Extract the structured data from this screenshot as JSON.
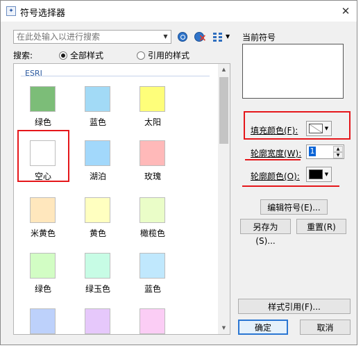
{
  "window": {
    "title": "符号选择器",
    "close_glyph": "✕"
  },
  "search": {
    "placeholder": "在此处输入以进行搜索",
    "label": "搜索:",
    "scope_all": "全部样式",
    "scope_referenced": "引用的样式",
    "selected_scope": "全部样式"
  },
  "symbol_group": {
    "name": "ESRI"
  },
  "symbols": [
    {
      "label": "绿色",
      "color": "#7cbd78"
    },
    {
      "label": "蓝色",
      "color": "#a2daf6"
    },
    {
      "label": "太阳",
      "color": "#fefe7a"
    },
    {
      "label": "空心",
      "color": "#ffffff"
    },
    {
      "label": "湖泊",
      "color": "#a2d8fb"
    },
    {
      "label": "玫瑰",
      "color": "#ffb9b9"
    },
    {
      "label": "米黄色",
      "color": "#ffe7bd"
    },
    {
      "label": "黄色",
      "color": "#ffffc0"
    },
    {
      "label": "橄榄色",
      "color": "#eafdc8"
    },
    {
      "label": "绿色",
      "color": "#d2fdc4"
    },
    {
      "label": "绿玉色",
      "color": "#c7fce5"
    },
    {
      "label": "蓝色",
      "color": "#c0e8fd"
    },
    {
      "label": "",
      "color": "#bdd1fb"
    },
    {
      "label": "",
      "color": "#e6c8fb"
    },
    {
      "label": "",
      "color": "#fbcdf5"
    }
  ],
  "current_symbol": {
    "label": "当前符号",
    "fill_color_label": "填充颜色(F):",
    "outline_width_label": "轮廓宽度(W):",
    "outline_width_value": "1",
    "outline_color_label": "轮廓颜色(O):",
    "outline_color": "#000000"
  },
  "buttons": {
    "edit_symbol": "编辑符号(E)...",
    "save_as": "另存为(S)...",
    "reset": "重置(R)",
    "style_references": "样式引用(F)...",
    "ok": "确定",
    "cancel": "取消"
  },
  "colors": {
    "annotation_red": "#e5161a",
    "group_title": "#2c5aa0"
  }
}
